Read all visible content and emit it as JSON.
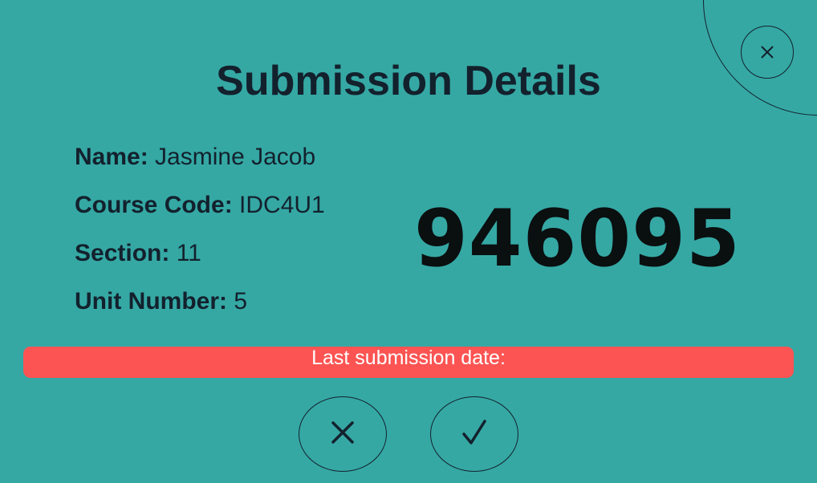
{
  "dialog": {
    "title": "Submission Details"
  },
  "fields": [
    {
      "label": "Name:",
      "value": "Jasmine Jacob"
    },
    {
      "label": "Course Code:",
      "value": "IDC4U1"
    },
    {
      "label": "Section:",
      "value": "11"
    },
    {
      "label": "Unit Number:",
      "value": "5"
    }
  ],
  "code": "946095",
  "banner": {
    "text": "Last submission date:"
  },
  "actions": {
    "close_icon": "close-icon",
    "reject_icon": "x-mark-icon",
    "accept_icon": "checkmark-icon"
  },
  "colors": {
    "background": "#35a8a4",
    "text": "#13212d",
    "banner": "#fb5452"
  }
}
